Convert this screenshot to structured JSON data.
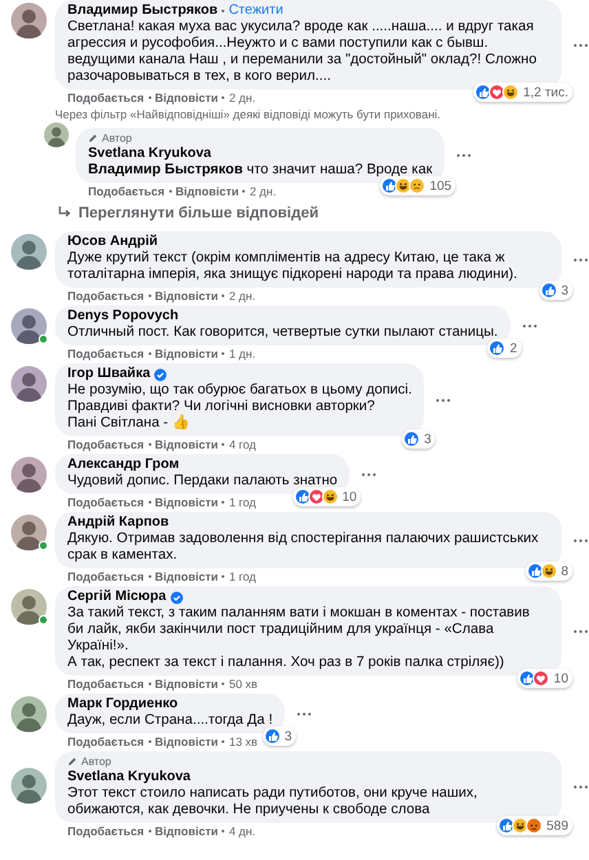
{
  "thread": [
    {
      "kind": "comment",
      "author": "Владимир Быстряков",
      "follow": "Стежити",
      "verified": false,
      "online": false,
      "text": "Светлана! какая муха вас укусила? вроде как .....наша.... и вдруг такая агрессия и русофобия...Неужто и с вами поступили как с бывш. ведущими канала Наш , и переманили за \"достойный\" оклад?! Сложно разочаровываться в тех, в кого верил....",
      "reactions": [
        {
          "kind": "like"
        },
        {
          "kind": "love"
        },
        {
          "kind": "haha"
        }
      ],
      "count": "1,2 тис.",
      "actions": [
        "Подобається",
        "Відповісти",
        "2 дн."
      ]
    },
    {
      "kind": "note",
      "text": "Через фільтр «Найвідповідніші» деякі відповіді можуть бути приховані."
    },
    {
      "kind": "reply",
      "badge": "Автор",
      "author": "Svetlana Kryukova",
      "verified": false,
      "online": false,
      "text": "**Владимир Быстряков** что значит наша? Вроде как",
      "reactions": [
        {
          "kind": "like"
        },
        {
          "kind": "haha"
        },
        {
          "kind": "sad"
        }
      ],
      "count": "105",
      "actions": [
        "Подобається",
        "Відповісти",
        "2 дн."
      ]
    },
    {
      "kind": "more",
      "text": "Переглянути більше відповідей"
    },
    {
      "kind": "comment",
      "author": "Юсов Андрій",
      "verified": false,
      "online": false,
      "text": "Дуже крутий текст (окрім компліментів на адресу Китаю, це така ж тоталітарна імперія, яка знищує підкорені народи та права людини).",
      "reactions": [
        {
          "kind": "like"
        }
      ],
      "count": "3",
      "actions": [
        "Подобається",
        "Відповісти",
        "2 дн."
      ]
    },
    {
      "kind": "comment",
      "author": "Denys Popovych",
      "verified": false,
      "online": true,
      "text": "Отличный пост. Как говорится, четвертые сутки пылают станицы.",
      "reactions": [
        {
          "kind": "like"
        }
      ],
      "count": "2",
      "actions": [
        "Подобається",
        "Відповісти",
        "1 дн."
      ]
    },
    {
      "kind": "comment",
      "author": "Ігор Швайка",
      "verified": true,
      "online": false,
      "text": "Не розумію, що так обурює багатьох в цьому дописі.\nПравдиві факти? Чи логічні висновки авторки?\nПані Світлана - 👍",
      "reactions": [
        {
          "kind": "like"
        }
      ],
      "count": "3",
      "actions": [
        "Подобається",
        "Відповісти",
        "4 год"
      ]
    },
    {
      "kind": "comment",
      "author": "Александр Гром",
      "verified": false,
      "online": false,
      "text": "Чудовий допис. Пердаки палають знатно",
      "reactions": [
        {
          "kind": "like"
        },
        {
          "kind": "love"
        },
        {
          "kind": "haha"
        }
      ],
      "count": "10",
      "actions": [
        "Подобається",
        "Відповісти",
        "1 год"
      ]
    },
    {
      "kind": "comment",
      "author": "Андрій Карпов",
      "verified": false,
      "online": true,
      "text": "Дякую. Отримав задоволення від спостерігання палаючих рашистських срак в каментах.",
      "reactions": [
        {
          "kind": "like"
        },
        {
          "kind": "haha"
        }
      ],
      "count": "8",
      "actions": [
        "Подобається",
        "Відповісти",
        "1 год"
      ]
    },
    {
      "kind": "comment",
      "author": "Сергій Місюра",
      "verified": true,
      "online": true,
      "text": "За такий текст, з таким паланням вати і мокшан в коментах - поставив би лайк, якби закінчили пост традиційним для українця - «Слава Україні!».\nА так, респект за текст і палання. Хоч раз в 7 років палка стріляє))",
      "reactions": [
        {
          "kind": "like"
        },
        {
          "kind": "love"
        }
      ],
      "count": "10",
      "actions": [
        "Подобається",
        "Відповісти",
        "50 хв"
      ]
    },
    {
      "kind": "comment",
      "author": "Марк Гордиенко",
      "verified": false,
      "online": false,
      "text": "Дауж, если Страна....тогда Да !",
      "reactions": [
        {
          "kind": "like"
        }
      ],
      "count": "3",
      "actions": [
        "Подобається",
        "Відповісти",
        "13 хв"
      ]
    },
    {
      "kind": "comment",
      "badge": "Автор",
      "author": "Svetlana Kryukova",
      "verified": false,
      "online": false,
      "text": "Этот текст стоило написать ради путиботов, они круче наших, обижаются, как девочки. Не приучены к свободе слова",
      "reactions": [
        {
          "kind": "like"
        },
        {
          "kind": "haha"
        },
        {
          "kind": "angry"
        }
      ],
      "count": "589",
      "actions": [
        "Подобається",
        "Відповісти",
        "4 дн."
      ]
    }
  ]
}
